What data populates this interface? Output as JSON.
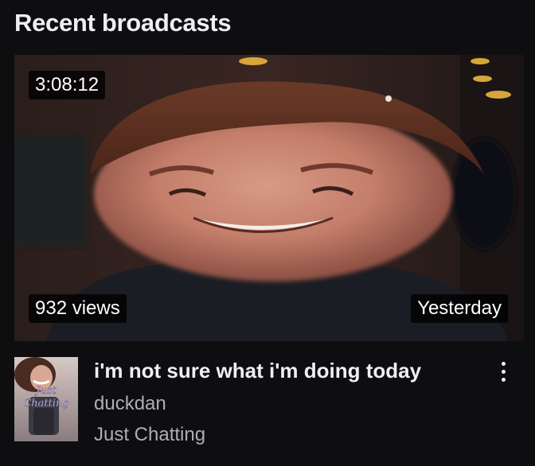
{
  "section": {
    "title": "Recent broadcasts"
  },
  "vod": {
    "duration": "3:08:12",
    "views": "932 views",
    "published": "Yesterday",
    "title": "i'm not sure what i'm doing today",
    "channel": "duckdan",
    "category": "Just Chatting",
    "category_art_lettering": "Just Chatting"
  },
  "colors": {
    "background": "#0e0e10",
    "primary_text": "#efeff1",
    "secondary_text": "#adadb8",
    "overlay_badge": "#000000"
  },
  "icons": {
    "more_options": "vertical-ellipsis-icon"
  }
}
